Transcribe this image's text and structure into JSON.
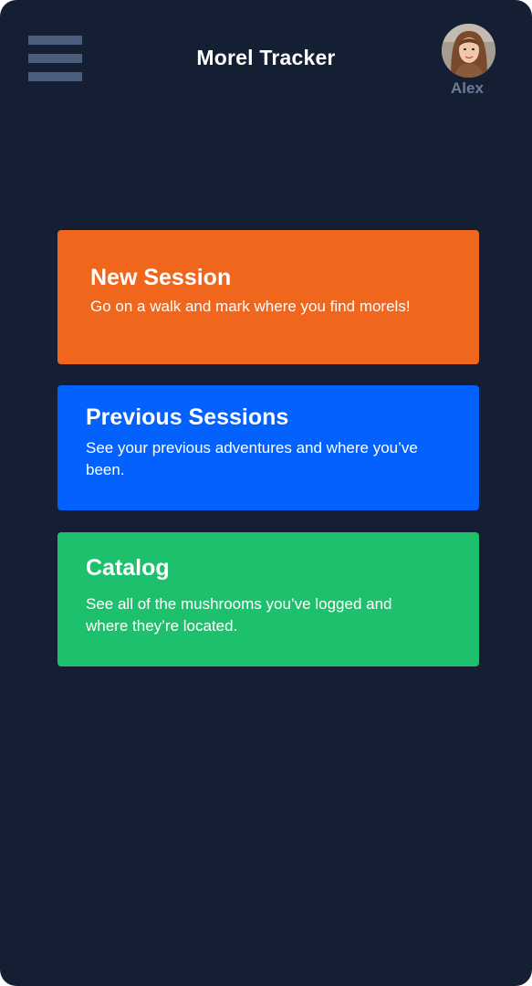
{
  "header": {
    "title": "Morel Tracker",
    "menu_icon": "hamburger-menu-icon",
    "user": {
      "name": "Alex",
      "avatar": "user-avatar-photo"
    }
  },
  "cards": [
    {
      "title": "New Session",
      "description": "Go on a walk and mark where you find morels!",
      "color": "#f1661d"
    },
    {
      "title": "Previous Sessions",
      "description": "See your previous adventures and where you’ve been.",
      "color": "#0361fd"
    },
    {
      "title": "Catalog",
      "description": "See all of the mushrooms you’ve logged and where they’re located.",
      "color": "#1dc16d"
    }
  ],
  "colors": {
    "background": "#141f33",
    "menu_icon": "#4b5e7e",
    "user_name": "#6b7c99"
  }
}
